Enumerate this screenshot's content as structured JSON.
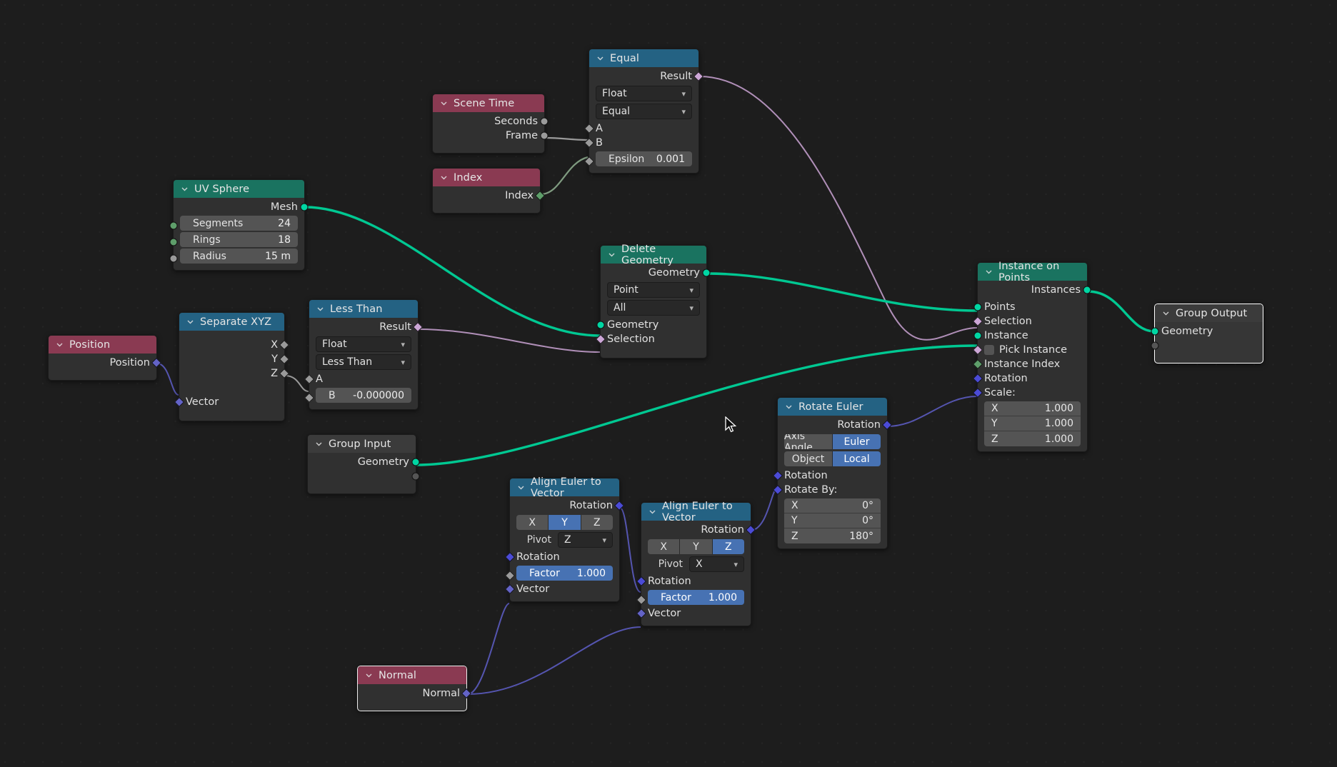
{
  "app": {
    "editor": "Blender Geometry Node Editor",
    "background": "#1d1d1d"
  },
  "colors": {
    "header_geometry": "#1a7360",
    "header_converter": "#246283",
    "header_input": "#8a3a52",
    "header_group": "#3b3b3b",
    "socket_geometry": "#00d6a3",
    "socket_boolean": "#cca6d6",
    "socket_vector": "#6363c7",
    "socket_rotation": "#4b4bd6",
    "socket_integer": "#5e9e6a",
    "socket_float": "#9a9a9a",
    "toggle_active": "#4772b3",
    "link_geometry": "#00c892",
    "link_boolean": "#b08fb8",
    "link_vector": "#5555b0"
  },
  "nodes": {
    "equal": {
      "title": "Equal",
      "outputs": [
        {
          "label": "Result",
          "type": "boolean"
        }
      ],
      "dropdowns": [
        {
          "value": "Float"
        },
        {
          "value": "Equal"
        }
      ],
      "inputs": [
        {
          "label": "A",
          "type": "float"
        },
        {
          "label": "B",
          "type": "float"
        }
      ],
      "props": [
        {
          "name": "Epsilon",
          "value": "0.001"
        }
      ]
    },
    "scene_time": {
      "title": "Scene Time",
      "outputs": [
        {
          "label": "Seconds",
          "type": "float"
        },
        {
          "label": "Frame",
          "type": "float"
        }
      ]
    },
    "index": {
      "title": "Index",
      "outputs": [
        {
          "label": "Index",
          "type": "integer"
        }
      ]
    },
    "uv_sphere": {
      "title": "UV Sphere",
      "outputs": [
        {
          "label": "Mesh",
          "type": "geometry"
        }
      ],
      "props": [
        {
          "name": "Segments",
          "value": "24",
          "type": "integer"
        },
        {
          "name": "Rings",
          "value": "18",
          "type": "integer"
        },
        {
          "name": "Radius",
          "value": "15 m",
          "type": "float"
        }
      ]
    },
    "position": {
      "title": "Position",
      "outputs": [
        {
          "label": "Position",
          "type": "vector"
        }
      ]
    },
    "separate_xyz": {
      "title": "Separate XYZ",
      "outputs": [
        {
          "label": "X",
          "type": "float"
        },
        {
          "label": "Y",
          "type": "float"
        },
        {
          "label": "Z",
          "type": "float"
        }
      ],
      "inputs": [
        {
          "label": "Vector",
          "type": "vector"
        }
      ]
    },
    "less_than": {
      "title": "Less Than",
      "outputs": [
        {
          "label": "Result",
          "type": "boolean"
        }
      ],
      "dropdowns": [
        {
          "value": "Float"
        },
        {
          "value": "Less Than"
        }
      ],
      "inputs": [
        {
          "label": "A",
          "type": "float"
        }
      ],
      "props": [
        {
          "name": "B",
          "value": "-0.000000"
        }
      ]
    },
    "delete_geometry": {
      "title": "Delete Geometry",
      "outputs": [
        {
          "label": "Geometry",
          "type": "geometry"
        }
      ],
      "dropdowns": [
        {
          "value": "Point"
        },
        {
          "value": "All"
        }
      ],
      "inputs": [
        {
          "label": "Geometry",
          "type": "geometry"
        },
        {
          "label": "Selection",
          "type": "boolean"
        }
      ]
    },
    "group_input": {
      "title": "Group Input",
      "outputs": [
        {
          "label": "Geometry",
          "type": "geometry"
        },
        {
          "label": "",
          "type": "empty"
        }
      ]
    },
    "group_output": {
      "title": "Group Output",
      "inputs": [
        {
          "label": "Geometry",
          "type": "geometry"
        },
        {
          "label": "",
          "type": "empty"
        }
      ]
    },
    "instance_on_points": {
      "title": "Instance on Points",
      "outputs": [
        {
          "label": "Instances",
          "type": "geometry"
        }
      ],
      "inputs": [
        {
          "label": "Points",
          "type": "geometry"
        },
        {
          "label": "Selection",
          "type": "boolean"
        },
        {
          "label": "Instance",
          "type": "geometry"
        },
        {
          "label": "Pick Instance",
          "type": "boolean",
          "checkbox": true,
          "checked": false
        },
        {
          "label": "Instance Index",
          "type": "integer"
        },
        {
          "label": "Rotation",
          "type": "rotation"
        },
        {
          "label": "Scale:",
          "type": "rotation"
        }
      ],
      "vector": [
        {
          "axis": "X",
          "value": "1.000"
        },
        {
          "axis": "Y",
          "value": "1.000"
        },
        {
          "axis": "Z",
          "value": "1.000"
        }
      ]
    },
    "rotate_euler": {
      "title": "Rotate Euler",
      "outputs": [
        {
          "label": "Rotation",
          "type": "rotation"
        }
      ],
      "segments": [
        {
          "options": [
            "Axis Angle",
            "Euler"
          ],
          "selected": "Euler"
        },
        {
          "options": [
            "Object",
            "Local"
          ],
          "selected": "Local"
        }
      ],
      "inputs": [
        {
          "label": "Rotation",
          "type": "rotation"
        },
        {
          "label": "Rotate By:",
          "type": "rotation"
        }
      ],
      "vector": [
        {
          "axis": "X",
          "value": "0°"
        },
        {
          "axis": "Y",
          "value": "0°"
        },
        {
          "axis": "Z",
          "value": "180°"
        }
      ]
    },
    "align_euler_1": {
      "title": "Align Euler to Vector",
      "outputs": [
        {
          "label": "Rotation",
          "type": "rotation"
        }
      ],
      "axis": {
        "options": [
          "X",
          "Y",
          "Z"
        ],
        "selected": "Y"
      },
      "pivot": {
        "label": "Pivot",
        "value": "Z"
      },
      "inputs": [
        {
          "label": "Rotation",
          "type": "rotation"
        },
        {
          "label": "Vector",
          "type": "vector"
        }
      ],
      "factor": {
        "name": "Factor",
        "value": "1.000"
      }
    },
    "align_euler_2": {
      "title": "Align Euler to Vector",
      "outputs": [
        {
          "label": "Rotation",
          "type": "rotation"
        }
      ],
      "axis": {
        "options": [
          "X",
          "Y",
          "Z"
        ],
        "selected": "Z"
      },
      "pivot": {
        "label": "Pivot",
        "value": "X"
      },
      "inputs": [
        {
          "label": "Rotation",
          "type": "rotation"
        },
        {
          "label": "Vector",
          "type": "vector"
        }
      ],
      "factor": {
        "name": "Factor",
        "value": "1.000"
      }
    },
    "normal": {
      "title": "Normal",
      "outputs": [
        {
          "label": "Normal",
          "type": "vector"
        }
      ]
    }
  }
}
